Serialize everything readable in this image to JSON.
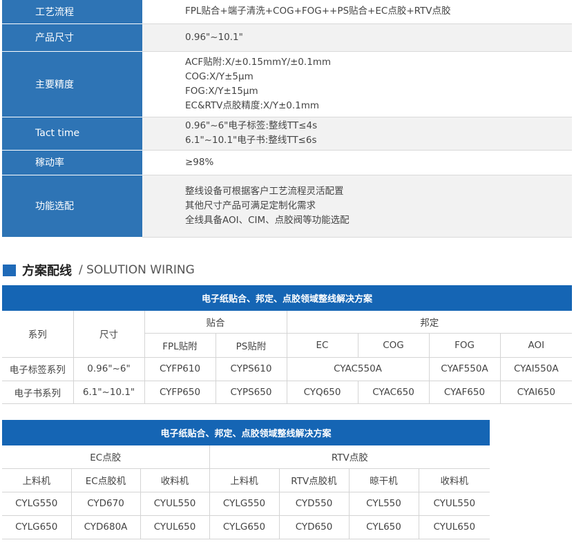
{
  "spec_rows": [
    {
      "label": "工艺流程",
      "lines": [
        "FPL贴合+端子清洗+COG+FOG++PS贴合+EC点胶+RTV点胶"
      ]
    },
    {
      "label": "产品尺寸",
      "lines": [
        "0.96\"~10.1\""
      ]
    },
    {
      "label": "主要精度",
      "lines": [
        "ACF贴附:X/±0.15mmY/±0.1mm",
        "COG:X/Y±5μm",
        "FOG:X/Y±15μm",
        "EC&RTV点胶精度:X/Y±0.1mm"
      ]
    },
    {
      "label": "Tact time",
      "lines": [
        "0.96\"~6\"电子标签:整线TT≤4s",
        "6.1\"~10.1\"电子书:整线TT≤6s"
      ]
    },
    {
      "label": "稼动率",
      "lines": [
        "≥98%"
      ]
    },
    {
      "label": "功能选配",
      "lines": [
        "整线设备可根据客户工艺流程灵活配置",
        "其他尺寸产品可满足定制化需求",
        "全线具备AOI、CIM、点胶阀等功能选配"
      ]
    }
  ],
  "section": {
    "title_cn": "方案配线",
    "title_en": "/ SOLUTION WIRING"
  },
  "table1": {
    "caption": "电子纸贴合、邦定、点胶领域整线解决方案",
    "h_series": "系列",
    "h_size": "尺寸",
    "h_lamination": "贴合",
    "h_bonding": "邦定",
    "sub": [
      "FPL贴附",
      "PS贴附",
      "EC",
      "COG",
      "FOG",
      "AOI"
    ],
    "row1": {
      "series": "电子标签系列",
      "size": "0.96\"~6\"",
      "fpl": "CYFP610",
      "ps": "CYPS610",
      "ec_cog": "CYAC550A",
      "fog": "CYAF550A",
      "aoi": "CYAI550A"
    },
    "row2": {
      "series": "电子书系列",
      "size": "6.1\"~10.1\"",
      "fpl": "CYFP650",
      "ps": "CYPS650",
      "ec": "CYQ650",
      "cog": "CYAC650",
      "fog": "CYAF650",
      "aoi": "CYAI650"
    }
  },
  "table2": {
    "caption": "电子纸贴合、邦定、点胶领域整线解决方案",
    "group_ec": "EC点胶",
    "group_rtv": "RTV点胶",
    "heads": [
      "上料机",
      "EC点胶机",
      "收料机",
      "上料机",
      "RTV点胶机",
      "晾干机",
      "收料机"
    ],
    "rows": [
      [
        "CYLG550",
        "CYD670",
        "CYUL550",
        "CYLG550",
        "CYD550",
        "CYL550",
        "CYUL550"
      ],
      [
        "CYLG650",
        "CYD680A",
        "CYUL650",
        "CYLG650",
        "CYD650",
        "CYL650",
        "CYUL650"
      ]
    ]
  }
}
